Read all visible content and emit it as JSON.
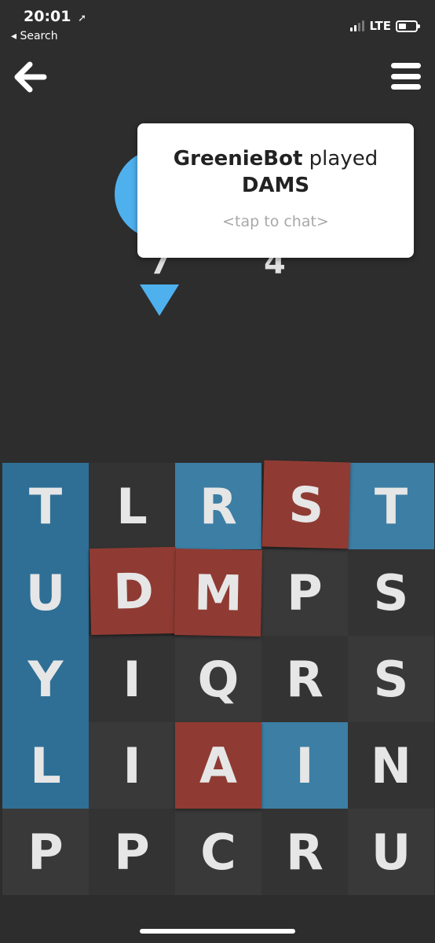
{
  "status_bar": {
    "time": "20:01",
    "back_label": "◂ Search",
    "network": "LTE"
  },
  "popup": {
    "player": "GreenieBot",
    "verb": "played",
    "word": "DAMS",
    "hint": "<tap to chat>"
  },
  "scores": {
    "left": "7",
    "right": "4"
  },
  "colors": {
    "blue_player": "#4fb0ee",
    "blue_tile": "#3c7ea4",
    "red_tile": "#8f3b33",
    "background": "#2d2d2d"
  },
  "board": {
    "rows": [
      [
        "T",
        "L",
        "R",
        "S",
        "T"
      ],
      [
        "U",
        "D",
        "M",
        "P",
        "S"
      ],
      [
        "Y",
        "I",
        "Q",
        "R",
        "S"
      ],
      [
        "L",
        "I",
        "A",
        "I",
        "N"
      ],
      [
        "P",
        "P",
        "C",
        "R",
        "U"
      ]
    ],
    "owners": [
      [
        "blue",
        "gray",
        "blue",
        "red",
        "blue"
      ],
      [
        "blue",
        "red",
        "red",
        "gray",
        "gray"
      ],
      [
        "blue",
        "gray",
        "gray",
        "gray",
        "gray"
      ],
      [
        "blue",
        "gray",
        "red",
        "blue",
        "gray"
      ],
      [
        "gray",
        "gray",
        "gray",
        "gray",
        "gray"
      ]
    ]
  }
}
